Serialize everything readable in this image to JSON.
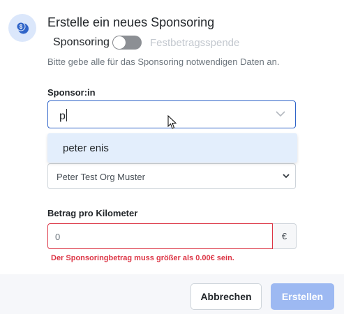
{
  "dialog": {
    "title": "Erstelle ein neues Sponsoring",
    "subtitle": "Bitte gebe alle für das Sponsoring notwendigen Daten an."
  },
  "toggle": {
    "left_label": "Sponsoring",
    "right_label": "Festbetragsspende",
    "state": "Sponsoring"
  },
  "sponsor": {
    "label": "Sponsor:in",
    "input_value": "p",
    "suggestions": [
      "peter enis"
    ]
  },
  "organization": {
    "selected": "Peter Test Org Muster"
  },
  "amount": {
    "label": "Betrag pro Kilometer",
    "placeholder": "0",
    "currency": "€",
    "error": "Der Sponsoringbetrag muss größer als 0.00€ sein."
  },
  "footer": {
    "cancel_label": "Abbrechen",
    "create_label": "Erstellen"
  },
  "colors": {
    "accent": "#2f64c8",
    "error": "#dc3545",
    "create_button": "#9db9f2"
  },
  "icons": {
    "header": "coins-icon",
    "combo": "chevron-down-icon",
    "select": "chevron-down-icon",
    "pointer": "mouse-cursor-icon"
  }
}
